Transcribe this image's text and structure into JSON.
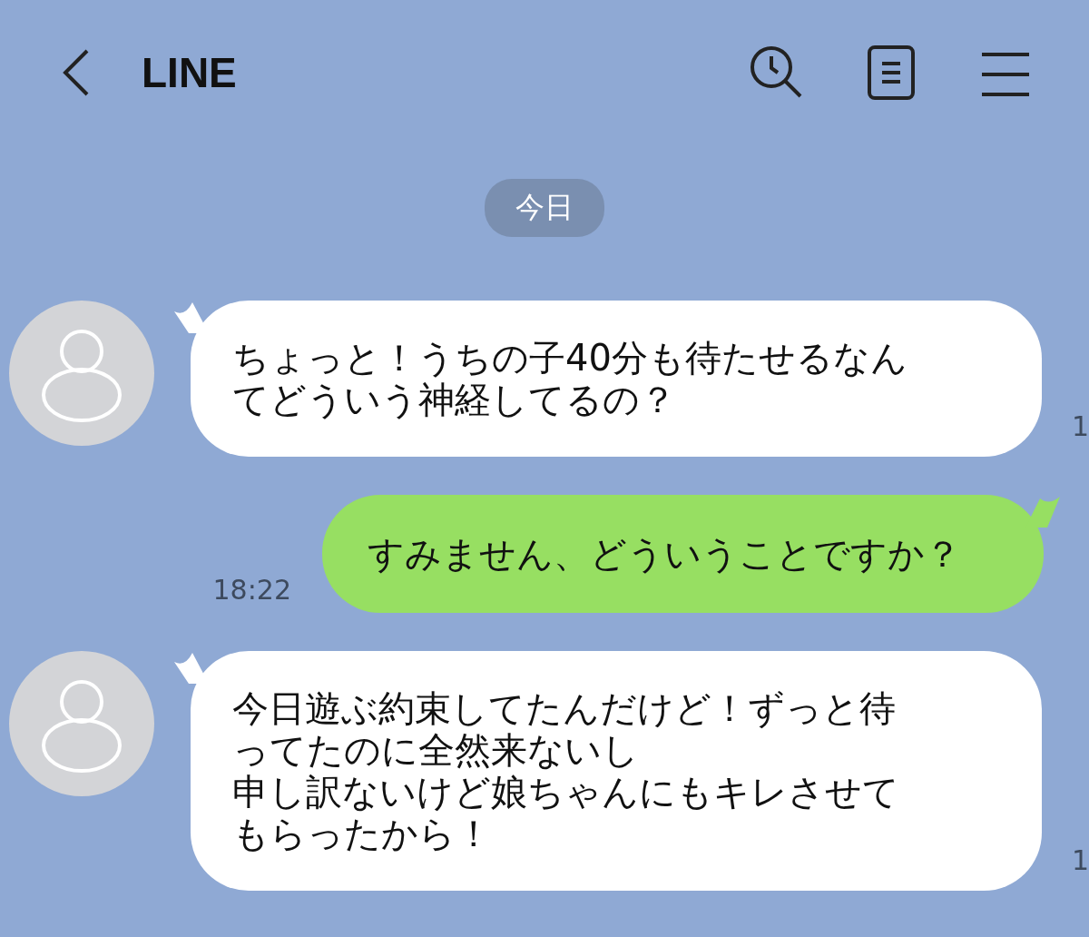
{
  "header": {
    "title": "LINE"
  },
  "date_label": "今日",
  "messages": [
    {
      "kind": "incoming",
      "paragraphs": [
        "ちょっと！うちの子40分も待たせるなんてどういう神経してるの？"
      ],
      "time": "1"
    },
    {
      "kind": "outgoing",
      "paragraphs": [
        "すみません、どういうことですか？"
      ],
      "time": "18:22"
    },
    {
      "kind": "incoming",
      "paragraphs": [
        "今日遊ぶ約束してたんだけど！ずっと待ってたのに全然来ないし",
        "申し訳ないけど娘ちゃんにもキレさせてもらったから！"
      ],
      "time": "1"
    }
  ]
}
